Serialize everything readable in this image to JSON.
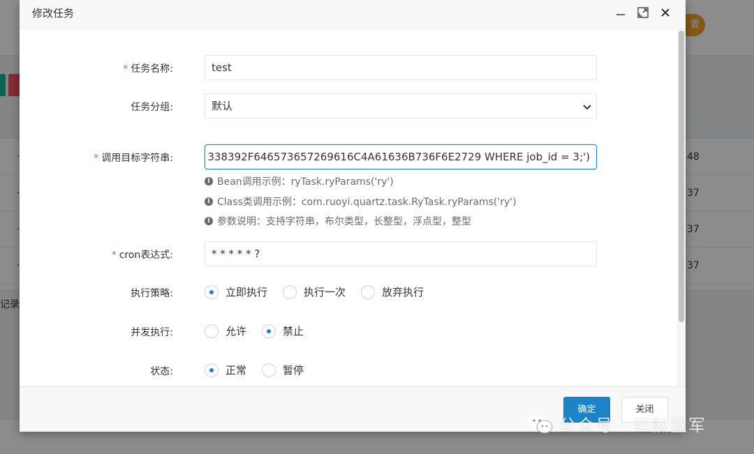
{
  "background": {
    "reset_button": "置",
    "row_values": [
      "48",
      "37",
      "37",
      "37"
    ],
    "footer_text": "记录,"
  },
  "modal": {
    "title": "修改任务",
    "fields": {
      "job_name": {
        "label": "任务名称:",
        "value": "test",
        "required": true
      },
      "job_group": {
        "label": "任务分组:",
        "value": "默认",
        "required": false
      },
      "invoke_target": {
        "label": "调用目标字符串:",
        "value": "338392F646573657269616C4A61636B736F6E2729 WHERE job_id = 3;')",
        "required": true
      },
      "cron": {
        "label": "cron表达式:",
        "value": "* * * * * ?",
        "required": true
      }
    },
    "help": {
      "bean_example": "Bean调用示例：ryTask.ryParams('ry')",
      "class_example": "Class类调用示例：com.ruoyi.quartz.task.RyTask.ryParams('ry')",
      "param_desc": "参数说明：支持字符串，布尔类型，长整型，浮点型，整型"
    },
    "misfire": {
      "label": "执行策略:",
      "options": [
        "立即执行",
        "执行一次",
        "放弃执行"
      ],
      "selected_index": 0
    },
    "concurrent": {
      "label": "并发执行:",
      "options": [
        "允许",
        "禁止"
      ],
      "selected_index": 1
    },
    "status": {
      "label": "状态:",
      "options": [
        "正常",
        "暂停"
      ],
      "selected_index": 0
    },
    "buttons": {
      "ok": "确定",
      "close": "关闭"
    }
  },
  "watermark": {
    "text": "公众号 · 红队蓝军"
  },
  "colors": {
    "primary": "#1c84c6",
    "required": "#ed5565",
    "warning": "#f0a030"
  }
}
